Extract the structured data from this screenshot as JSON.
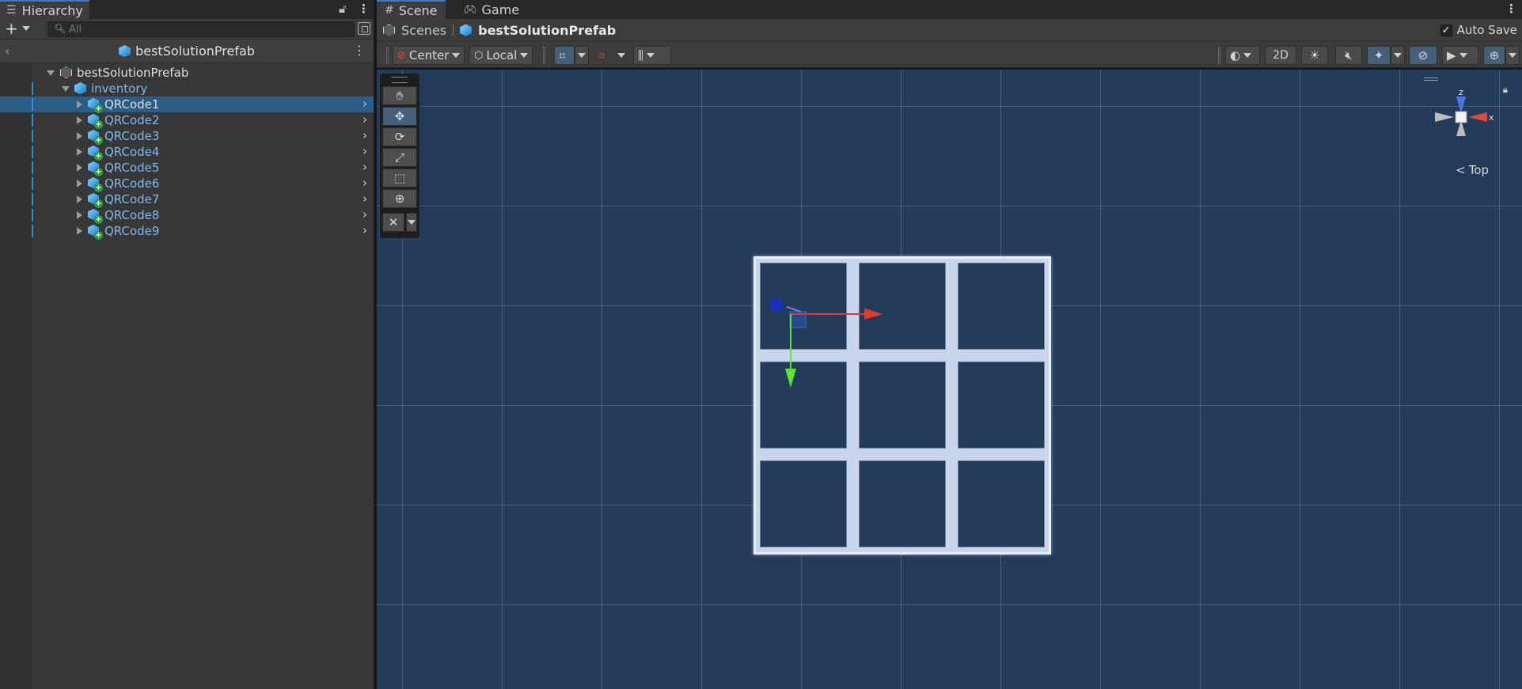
{
  "hierarchy": {
    "tab_label": "Hierarchy",
    "search_placeholder": "All",
    "header_title": "bestSolutionPrefab",
    "tree": {
      "root": "bestSolutionPrefab",
      "parent": "inventory",
      "children": [
        "QRCode1",
        "QRCode2",
        "QRCode3",
        "QRCode4",
        "QRCode5",
        "QRCode6",
        "QRCode7",
        "QRCode8",
        "QRCode9"
      ],
      "selected_index": 0
    }
  },
  "scene": {
    "tabs": [
      {
        "label": "Scene",
        "icon": "grid-icon",
        "active": true
      },
      {
        "label": "Game",
        "icon": "gamepad-icon",
        "active": false
      }
    ],
    "breadcrumb": {
      "scenes_label": "Scenes",
      "prefab_label": "bestSolutionPrefab"
    },
    "auto_save": {
      "label": "Auto Save",
      "checked": true
    },
    "toolbar": {
      "pivot_label": "Center",
      "space_label": "Local",
      "mode_2d_label": "2D"
    },
    "orientation": {
      "axis_z": "z",
      "axis_x": "x",
      "view_label": "Top"
    }
  },
  "colors": {
    "viewport_bg": "#233c5a",
    "selection": "#2c5d87",
    "accent": "#3a79bb",
    "x_axis": "#e03a2e",
    "y_axis": "#5ee23a",
    "z_axis": "#2a3fd6"
  }
}
